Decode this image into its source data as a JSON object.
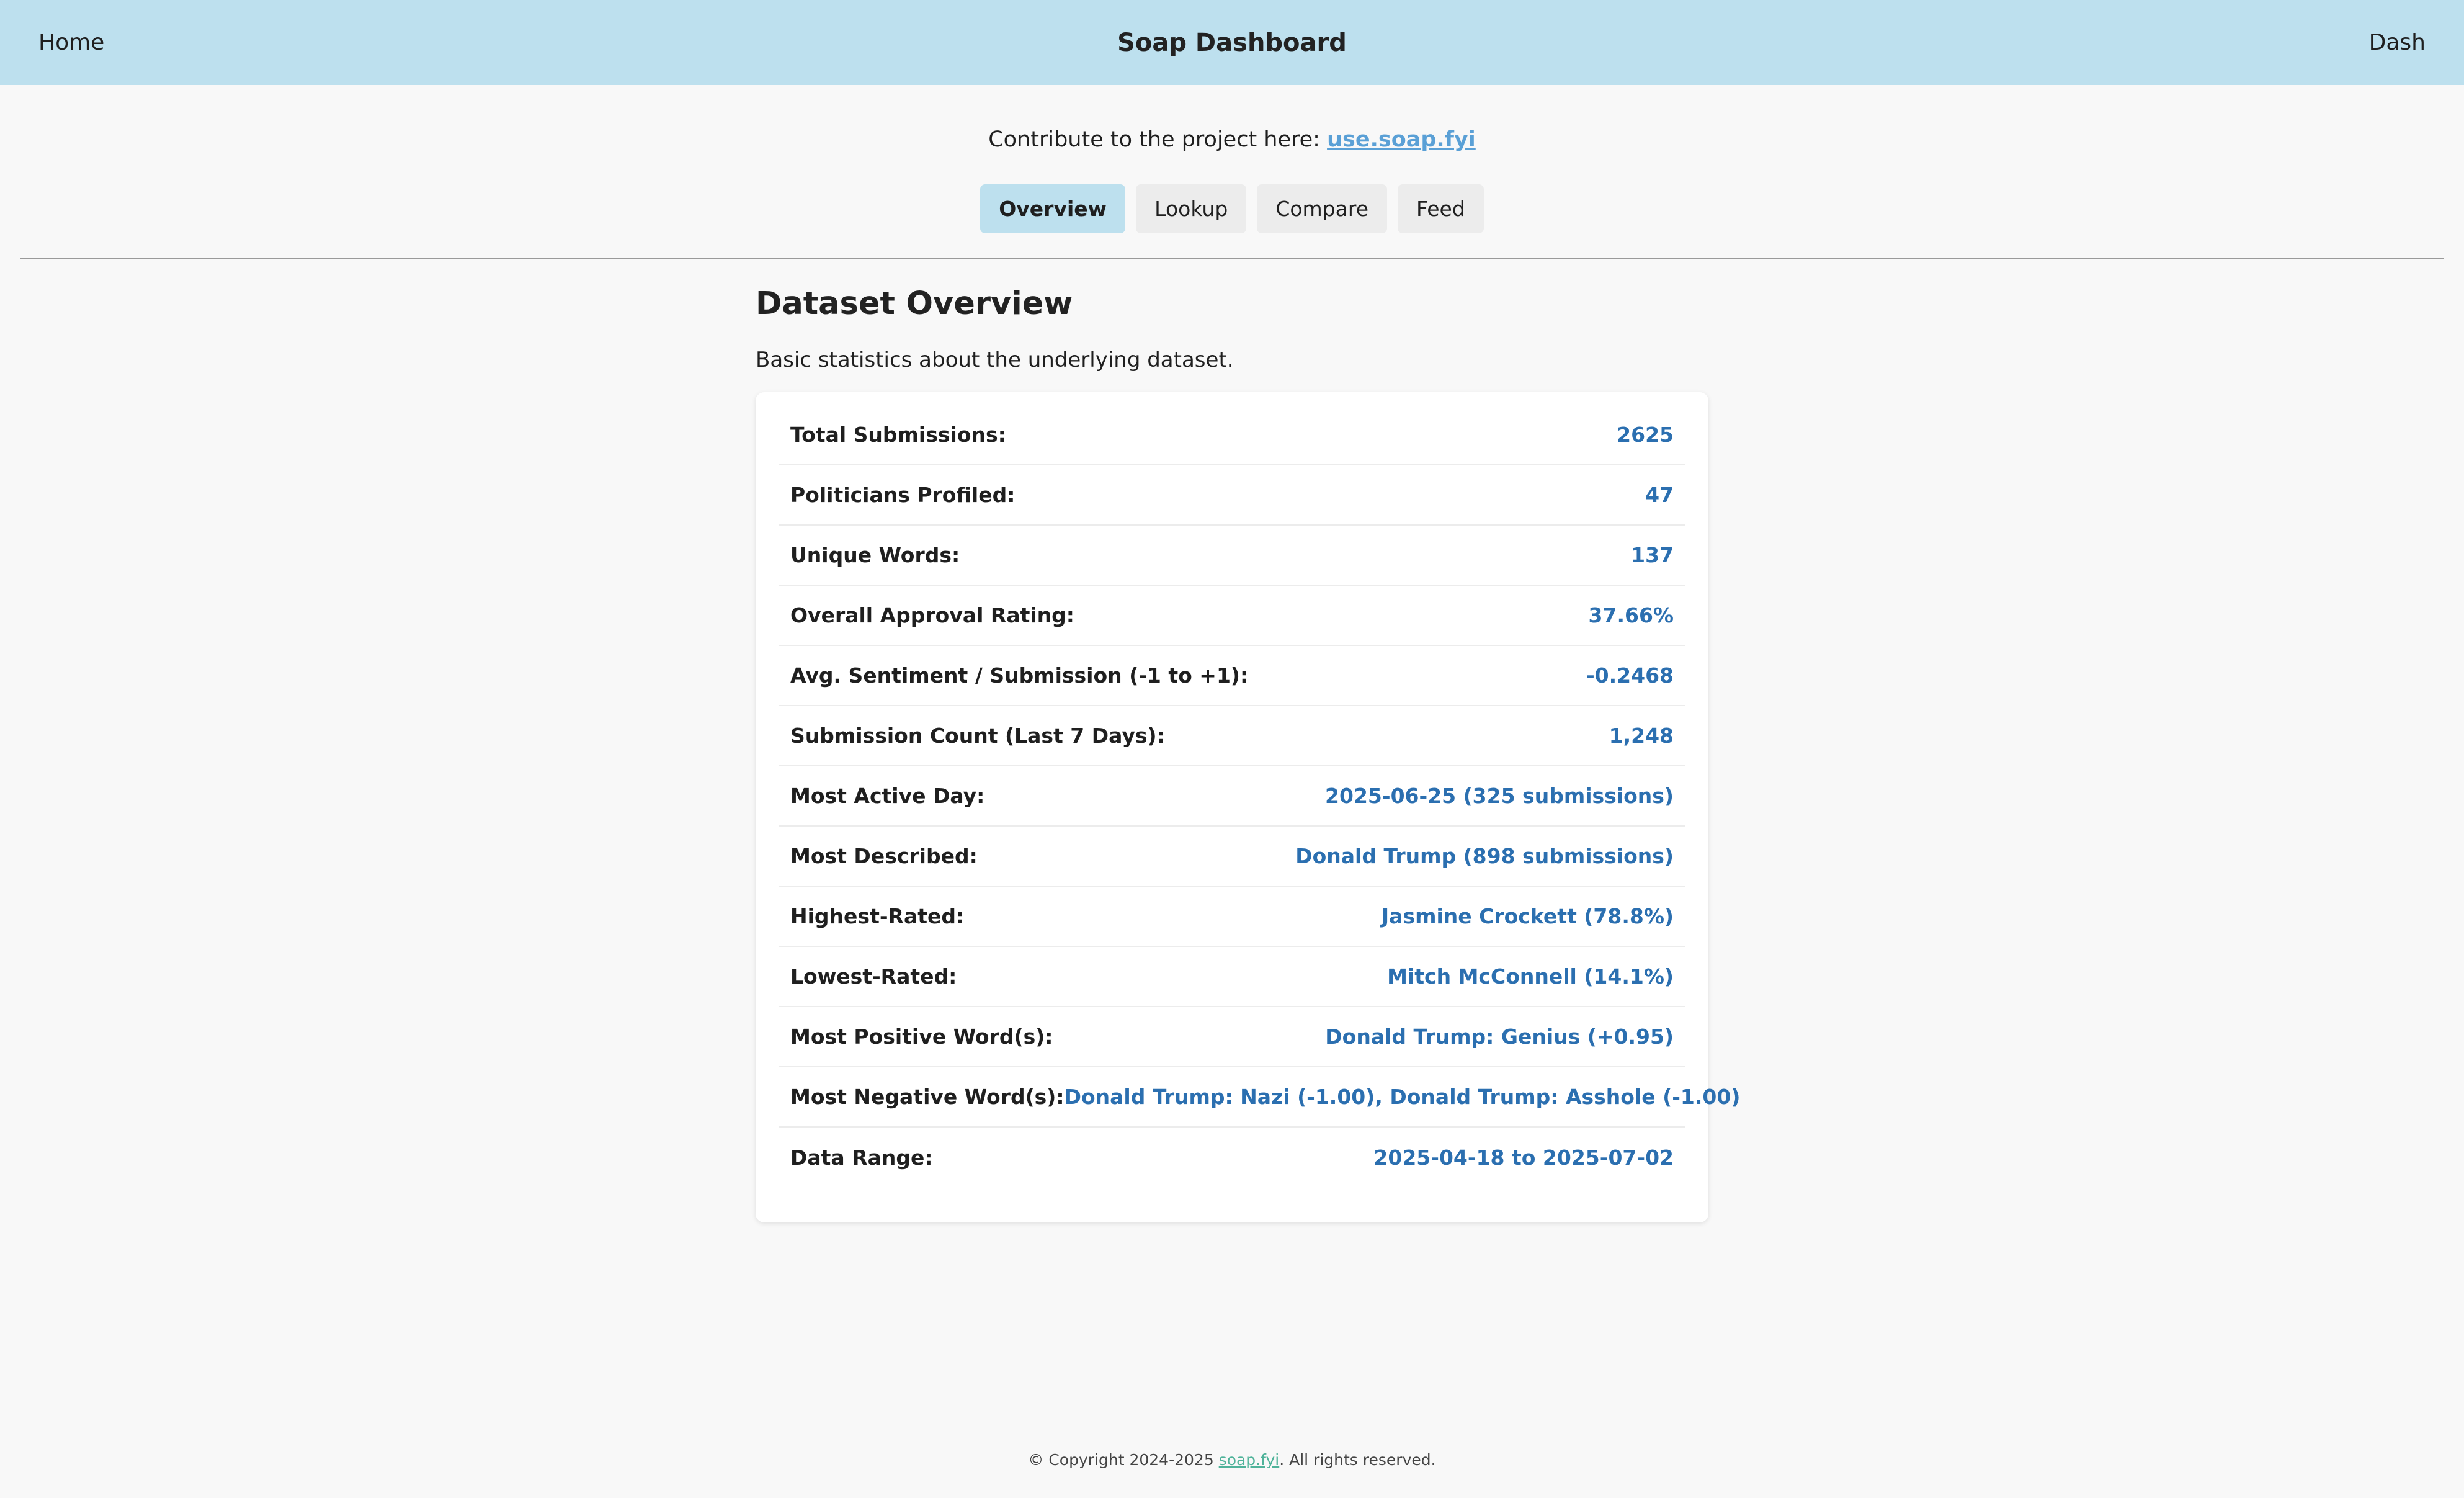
{
  "header": {
    "home_label": "Home",
    "title": "Soap Dashboard",
    "dash_label": "Dash"
  },
  "contribute": {
    "prefix": "Contribute to the project here: ",
    "link_text": "use.soap.fyi"
  },
  "tabs": [
    {
      "label": "Overview",
      "active": true
    },
    {
      "label": "Lookup",
      "active": false
    },
    {
      "label": "Compare",
      "active": false
    },
    {
      "label": "Feed",
      "active": false
    }
  ],
  "overview": {
    "heading": "Dataset Overview",
    "description": "Basic statistics about the underlying dataset.",
    "stats": [
      {
        "label": "Total Submissions:",
        "value": "2625"
      },
      {
        "label": "Politicians Profiled:",
        "value": "47"
      },
      {
        "label": "Unique Words:",
        "value": "137"
      },
      {
        "label": "Overall Approval Rating:",
        "value": "37.66%"
      },
      {
        "label": "Avg. Sentiment / Submission (-1 to +1):",
        "value": "-0.2468"
      },
      {
        "label": "Submission Count (Last 7 Days):",
        "value": "1,248"
      },
      {
        "label": "Most Active Day:",
        "value": "2025-06-25 (325 submissions)"
      },
      {
        "label": "Most Described:",
        "value": "Donald Trump (898 submissions)"
      },
      {
        "label": "Highest-Rated:",
        "value": "Jasmine Crockett (78.8%)"
      },
      {
        "label": "Lowest-Rated:",
        "value": "Mitch McConnell (14.1%)"
      },
      {
        "label": "Most Positive Word(s):",
        "value": "Donald Trump: Genius (+0.95)"
      },
      {
        "label": "Most Negative Word(s):",
        "value": "Donald Trump: Nazi (-1.00), Donald Trump: Asshole (-1.00)"
      },
      {
        "label": "Data Range:",
        "value": "2025-04-18 to 2025-07-02"
      }
    ]
  },
  "footer": {
    "prefix": "© Copyright 2024-2025 ",
    "link_text": "soap.fyi",
    "suffix": ". All rights reserved."
  },
  "colors": {
    "header_bg": "#bde0ee",
    "value_blue": "#2b6fb0",
    "link_blue": "#5aa0d6",
    "footer_link": "#4fb39a"
  }
}
